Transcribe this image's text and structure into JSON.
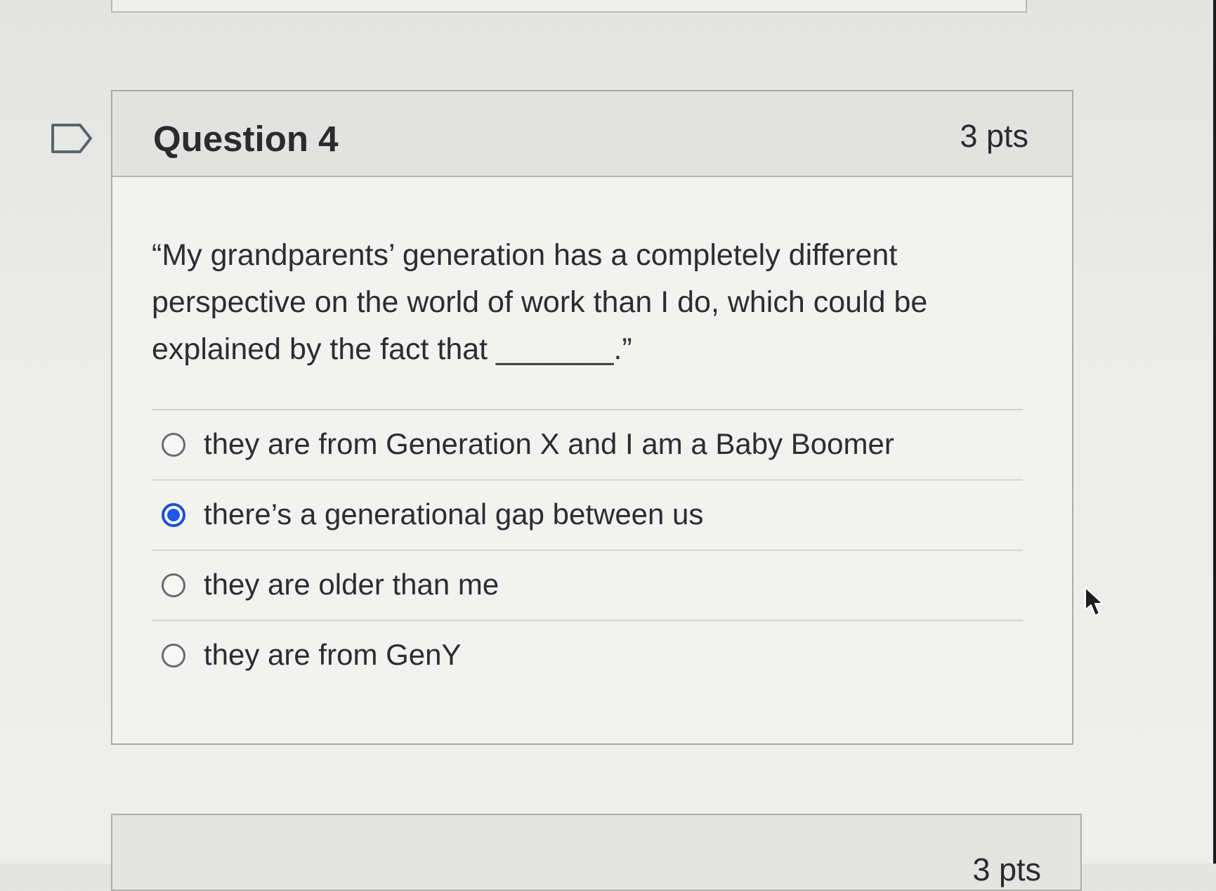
{
  "question": {
    "title": "Question 4",
    "points": "3 pts",
    "text": "“My grandparents’ generation has a completely different perspective on the world of work than I do, which could be explained by the fact that _______.”",
    "answers": [
      {
        "label": "they are from Generation X and I am a Baby Boomer",
        "selected": false
      },
      {
        "label": "there’s a generational gap between us",
        "selected": true
      },
      {
        "label": "they are older than me",
        "selected": false
      },
      {
        "label": "they are from GenY",
        "selected": false
      }
    ]
  },
  "next_question": {
    "points": "3 pts"
  },
  "icons": {
    "flag": "flag-icon",
    "radio": "radio-button-icon",
    "cursor": "mouse-pointer-icon"
  },
  "colors": {
    "selected_radio": "#1b5ae8"
  }
}
